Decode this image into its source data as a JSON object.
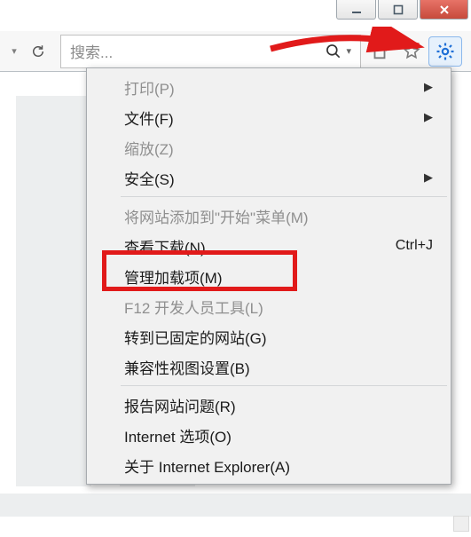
{
  "window": {
    "minimize": "—",
    "maximize": "▢",
    "close": "✕"
  },
  "toolbar": {
    "search_placeholder": "搜索...",
    "dropdown_glyph": "▾",
    "refresh_glyph": "↻",
    "search_icon_glyph": "⌕",
    "home_glyph": "⌂",
    "star_glyph": "★"
  },
  "menu": {
    "items": [
      {
        "label": "打印(P)",
        "disabled": true,
        "submenu": true
      },
      {
        "label": "文件(F)",
        "submenu": true
      },
      {
        "label": "缩放(Z)",
        "disabled": true,
        "submenu": false
      },
      {
        "label": "安全(S)",
        "submenu": true
      },
      {
        "sep": true
      },
      {
        "label": "将网站添加到\"开始\"菜单(M)",
        "disabled": true
      },
      {
        "label": "查看下载(N)",
        "shortcut": "Ctrl+J"
      },
      {
        "label": "管理加载项(M)"
      },
      {
        "label": "F12 开发人员工具(L)",
        "disabled": true
      },
      {
        "label": "转到已固定的网站(G)"
      },
      {
        "label": "兼容性视图设置(B)"
      },
      {
        "sep": true
      },
      {
        "label": "报告网站问题(R)"
      },
      {
        "label": "Internet 选项(O)"
      },
      {
        "label": "关于 Internet Explorer(A)"
      }
    ]
  }
}
